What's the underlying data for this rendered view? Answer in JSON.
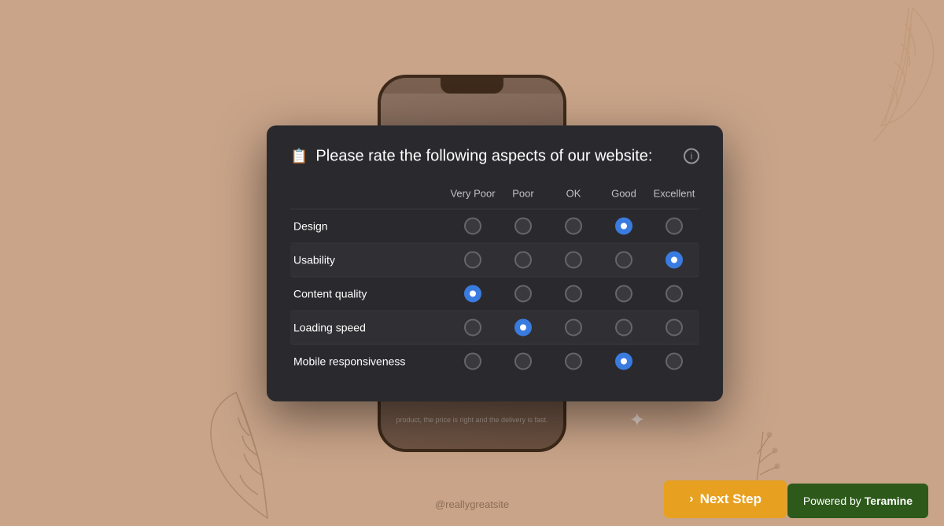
{
  "background": {
    "color": "#c9a489"
  },
  "modal": {
    "title": "Please rate the following aspects of our website:",
    "title_icon": "📋",
    "info_icon": "i",
    "columns": [
      "Very Poor",
      "Poor",
      "OK",
      "Good",
      "Excellent"
    ],
    "rows": [
      {
        "label": "Design",
        "selected": 3
      },
      {
        "label": "Usability",
        "selected": 4
      },
      {
        "label": "Content quality",
        "selected": 0
      },
      {
        "label": "Loading speed",
        "selected": 1
      },
      {
        "label": "Mobile responsiveness",
        "selected": 3
      }
    ]
  },
  "phone": {
    "text": "product, the price is right and the delivery is fast."
  },
  "watermark": "@reallygreatsite",
  "next_step": {
    "label": "Next Step",
    "arrow": "›"
  },
  "powered_by": {
    "prefix": "Powered by",
    "brand": "Teramine"
  }
}
